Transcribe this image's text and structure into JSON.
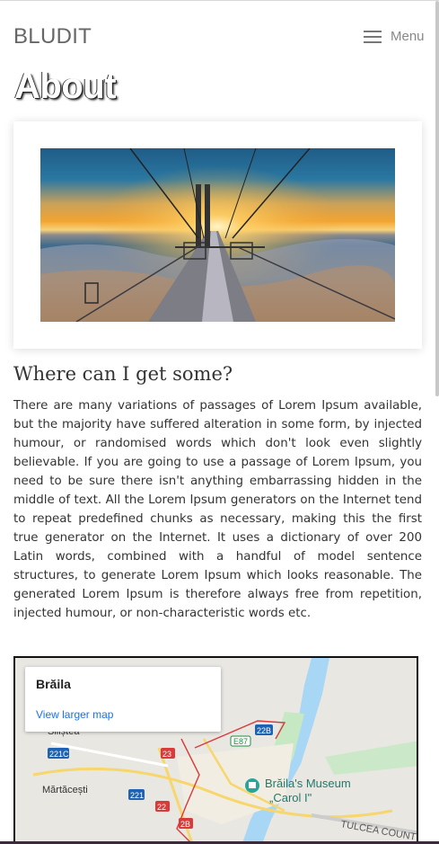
{
  "header": {
    "brand": "BLUDIT",
    "menu_label": "Menu"
  },
  "page": {
    "title": "About",
    "hero_icon": "bridge-sunset-photo"
  },
  "article": {
    "heading": "Where can I get some?",
    "paragraph": "There are many variations of passages of Lorem Ipsum available, but the majority have suffered alteration in some form, by injected humour, or randomised words which don't look even slightly believable. If you are going to use a passage of Lorem Ipsum, you need to be sure there isn't anything embarrassing hidden in the middle of text. All the Lorem Ipsum generators on the Internet tend to repeat predefined chunks as necessary, making this the first true generator on the Internet. It uses a dictionary of over 200 Latin words, combined with a handful of model sentence structures, to generate Lorem Ipsum which looks reasonable. The generated Lorem Ipsum is therefore always free from repetition, injected humour, or non-characteristic words etc."
  },
  "map": {
    "place": "Brăila",
    "larger_map_link": "View larger map",
    "labels": {
      "museum_line1": "Brăila's Museum",
      "museum_line2": "„Carol I\"",
      "town": "Mărtăcești",
      "town_top": "Siliștea",
      "county": "TULCEA COUNTY",
      "road_e87": "E87",
      "road_22b": "22B",
      "road_23": "23",
      "road_221c": "221C",
      "road_221": "221",
      "road_22": "22",
      "road_2b": "2B"
    },
    "colors": {
      "river": "#a8d6f5",
      "land": "#e9e7e2",
      "park": "#c6e9c4",
      "road": "#f6d66d",
      "route_badge": "#1e63b3",
      "border": "#d93a3a"
    }
  },
  "colors": {
    "brand_text": "#666666",
    "link": "#1a73e8"
  }
}
